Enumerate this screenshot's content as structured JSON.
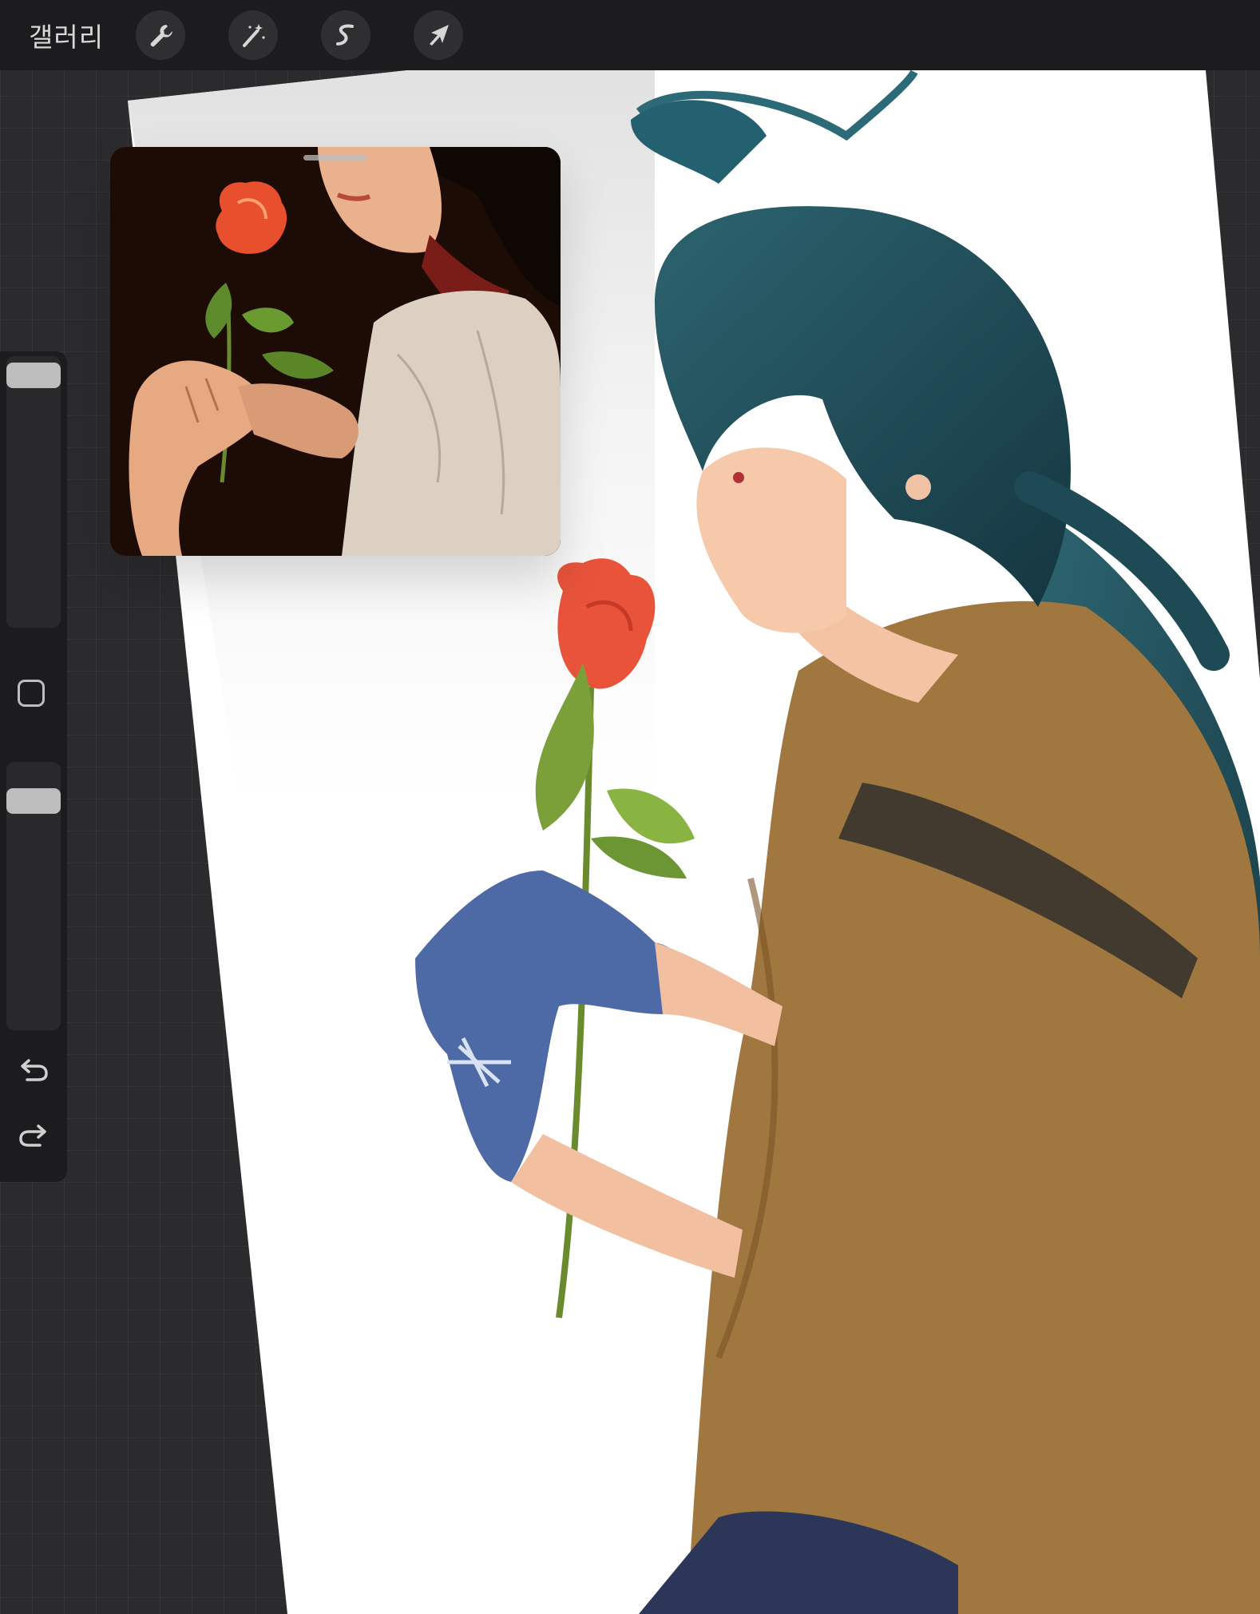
{
  "topbar": {
    "gallery_label": "갤러리",
    "tools": [
      {
        "name": "wrench-icon",
        "action": "actions"
      },
      {
        "name": "magic-wand-icon",
        "action": "adjustments"
      },
      {
        "name": "selection-s-icon",
        "action": "selection"
      },
      {
        "name": "arrow-cursor-icon",
        "action": "transform"
      }
    ]
  },
  "sidebar": {
    "brush_size_slider": {
      "value_percent": 100
    },
    "opacity_slider": {
      "value_percent": 100
    },
    "modify_button": "square-icon",
    "undo_icon": "undo-icon",
    "redo_icon": "redo-icon"
  },
  "reference_window": {
    "content": "photo-reference"
  },
  "canvas": {
    "background": "#ffffff",
    "accent_colors": {
      "hair": "#1f4a55",
      "rose": "#e8533a",
      "leaves": "#7ba03a",
      "glove": "#4e6aa6",
      "jacket": "#a0773e",
      "skin": "#f5c6a5"
    }
  }
}
